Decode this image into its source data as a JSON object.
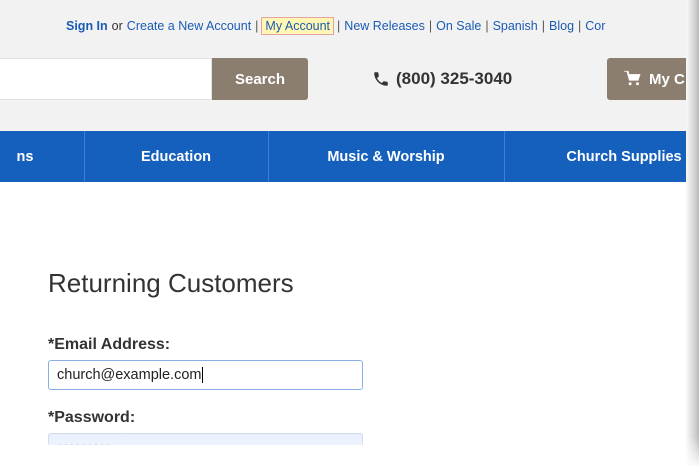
{
  "top_links": {
    "sign_in": "Sign In",
    "or": "or",
    "create_account": "Create a New Account",
    "my_account": "My Account",
    "new_releases": "New Releases",
    "on_sale": "On Sale",
    "spanish": "Spanish",
    "blog": "Blog",
    "contact_partial": "Cor"
  },
  "header": {
    "search_placeholder": "",
    "search_button": "Search",
    "phone": "(800) 325-3040",
    "cart_label": "My C"
  },
  "nav": {
    "items": [
      "ns",
      "Education",
      "Music & Worship",
      "Church Supplies"
    ]
  },
  "login": {
    "title": "Returning Customers",
    "email_label": "*Email Address:",
    "email_value": "church@example.com",
    "password_label": "*Password:",
    "password_value": "•••••••••"
  },
  "colors": {
    "nav_blue": "#1560bd",
    "button_taupe": "#8b7e6f",
    "link_blue": "#1a5bb5",
    "highlight": "#fff7b3"
  }
}
